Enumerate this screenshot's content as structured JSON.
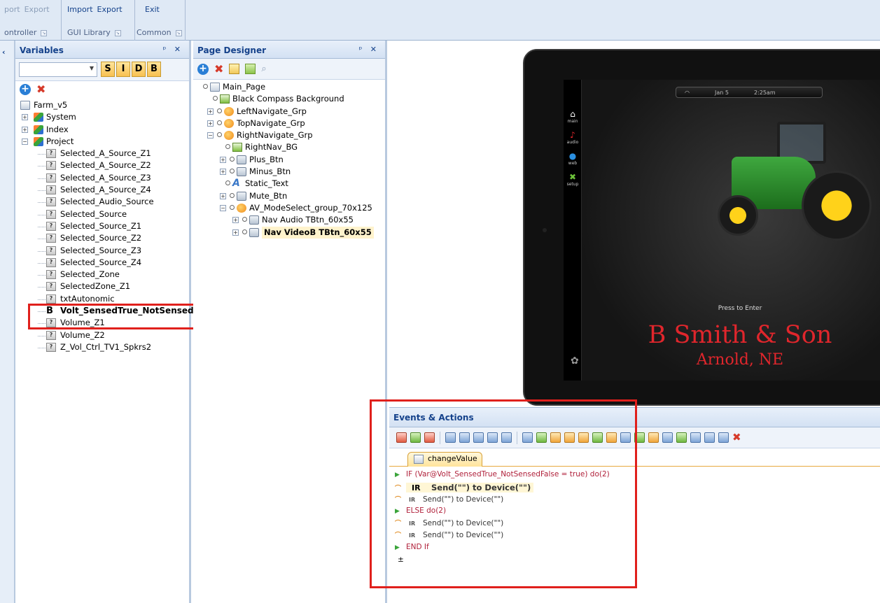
{
  "ribbon": {
    "groups": [
      {
        "buttons": [
          "port",
          "Export"
        ],
        "label": "ontroller"
      },
      {
        "buttons": [
          "Import",
          "Export"
        ],
        "label": "GUI Library"
      },
      {
        "buttons": [
          "Exit"
        ],
        "label": "Common"
      }
    ]
  },
  "variables_panel": {
    "title": "Variables",
    "controls": "p ×",
    "filter_buttons": [
      "S",
      "I",
      "D",
      "B"
    ],
    "tree": {
      "root": "Farm_v5",
      "groups": [
        "System",
        "Index",
        "Project"
      ],
      "items": [
        "Selected_A_Source_Z1",
        "Selected_A_Source_Z2",
        "Selected_A_Source_Z3",
        "Selected_A_Source_Z4",
        "Selected_Audio_Source",
        "Selected_Source",
        "Selected_Source_Z1",
        "Selected_Source_Z2",
        "Selected_Source_Z3",
        "Selected_Source_Z4",
        "Selected_Zone",
        "SelectedZone_Z1",
        "txtAutonomic",
        "Volt_SensedTrue_NotSensed",
        "Volume_Z1",
        "Volume_Z2",
        "Z_Vol_Ctrl_TV1_Spkrs2"
      ],
      "selected": "Volt_SensedTrue_NotSensed"
    }
  },
  "page_designer": {
    "title": "Page Designer",
    "tree": [
      {
        "label": "Main_Page"
      },
      {
        "label": "Black Compass Background"
      },
      {
        "label": "LeftNavigate_Grp"
      },
      {
        "label": "TopNavigate_Grp"
      },
      {
        "label": "RightNavigate_Grp"
      },
      {
        "label": "RightNav_BG"
      },
      {
        "label": "Plus_Btn"
      },
      {
        "label": "Minus_Btn"
      },
      {
        "label": "Static_Text"
      },
      {
        "label": "Mute_Btn"
      },
      {
        "label": "AV_ModeSelect_group_70x125"
      },
      {
        "label": "Nav Audio TBtn_60x55"
      },
      {
        "label": "Nav VideoB TBtn_60x55"
      }
    ]
  },
  "preview": {
    "status_date": "Jan 5",
    "status_time": "2:25am",
    "nav": [
      {
        "icon": "home-icon",
        "label": "main"
      },
      {
        "icon": "music-note-icon",
        "label": "audio"
      },
      {
        "icon": "globe-icon",
        "label": "web"
      },
      {
        "icon": "tools-icon",
        "label": "setup"
      }
    ],
    "press_text": "Press to Enter",
    "brand": "B Smith & Son",
    "town": "Arnold, NE"
  },
  "events": {
    "title": "Events & Actions",
    "tab": "changeValue",
    "lines": [
      {
        "icon": "if-icon",
        "text": "IF (Var@Volt_SensedTrue_NotSensedFalse = true) do(2)",
        "kind": "keyword"
      },
      {
        "icon": "ir-icon",
        "tag": "IR",
        "text": "Send(\"\") to Device(\"\")",
        "kind": "selected"
      },
      {
        "icon": "ir-icon",
        "tag": "IR",
        "text": "Send(\"\") to Device(\"\")",
        "kind": "action"
      },
      {
        "icon": "else-icon",
        "text": "ELSE do(2)",
        "kind": "keyword"
      },
      {
        "icon": "ir-icon",
        "tag": "IR",
        "text": "Send(\"\") to Device(\"\")",
        "kind": "action"
      },
      {
        "icon": "ir-icon",
        "tag": "IR",
        "text": "Send(\"\") to Device(\"\")",
        "kind": "action"
      },
      {
        "icon": "endif-icon",
        "text": "END If",
        "kind": "keyword"
      }
    ]
  },
  "colors": {
    "highlight_box": "#e0201c",
    "brand_red": "#e0262c",
    "ribbon_bg": "#dfe9f5"
  }
}
